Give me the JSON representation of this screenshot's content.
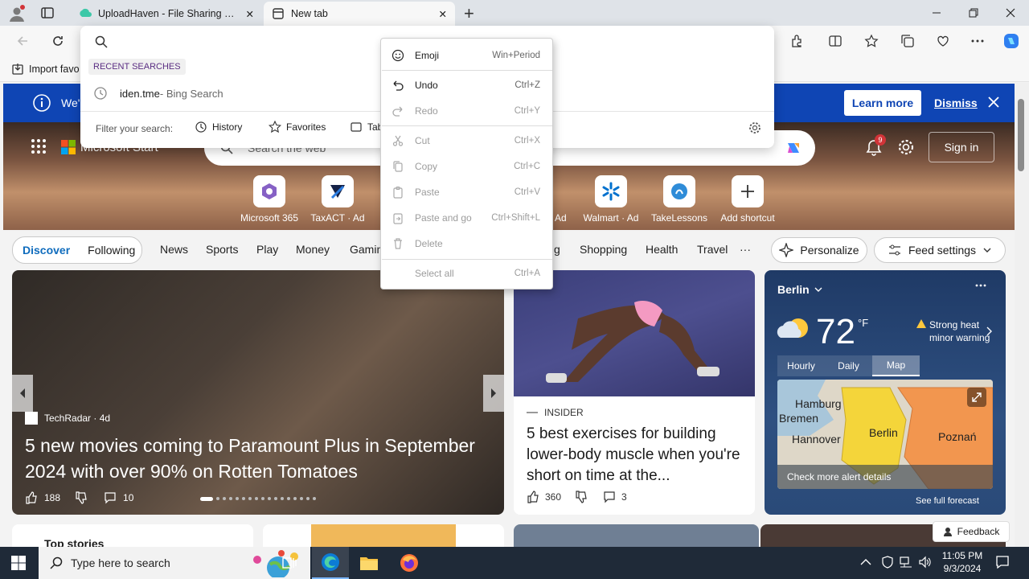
{
  "browser": {
    "tabs": [
      {
        "title": "UploadHaven - File Sharing Made"
      },
      {
        "title": "New tab"
      }
    ],
    "favorites_bar": {
      "import_label": "Import favo"
    }
  },
  "omnibox": {
    "recent_header": "RECENT SEARCHES",
    "recent_item": "iden.tme",
    "recent_item_suffix": " - Bing Search",
    "filter_label": "Filter your search:",
    "filters": [
      "History",
      "Favorites",
      "Tab"
    ]
  },
  "context_menu": {
    "items": [
      {
        "label": "Emoji",
        "shortcut": "Win+Period",
        "enabled": true
      },
      {
        "label": "Undo",
        "shortcut": "Ctrl+Z",
        "enabled": true
      },
      {
        "label": "Redo",
        "shortcut": "Ctrl+Y",
        "enabled": false
      },
      {
        "label": "Cut",
        "shortcut": "Ctrl+X",
        "enabled": false
      },
      {
        "label": "Copy",
        "shortcut": "Ctrl+C",
        "enabled": false
      },
      {
        "label": "Paste",
        "shortcut": "Ctrl+V",
        "enabled": false
      },
      {
        "label": "Paste and go",
        "shortcut": "Ctrl+Shift+L",
        "enabled": false
      },
      {
        "label": "Delete",
        "shortcut": "",
        "enabled": false
      },
      {
        "label": "Select all",
        "shortcut": "Ctrl+A",
        "enabled": false
      }
    ]
  },
  "banner": {
    "text": "We'",
    "learn_more": "Learn more",
    "dismiss": "Dismiss"
  },
  "msn": {
    "brand": "Microsoft Start",
    "search_placeholder": "Search the web",
    "notification_count": "9",
    "sign_in": "Sign in",
    "shortcuts": [
      {
        "label": "Microsoft 365"
      },
      {
        "label": "TaxACT · Ad"
      },
      {
        "label": "· Ad"
      },
      {
        "label": "Walmart · Ad"
      },
      {
        "label": "TakeLessons"
      },
      {
        "label": "Add shortcut"
      }
    ],
    "nav": {
      "discover": "Discover",
      "following": "Following",
      "items": [
        "News",
        "Sports",
        "Play",
        "Money",
        "Gamin",
        "g",
        "Shopping",
        "Health",
        "Travel",
        "···"
      ],
      "personalize": "Personalize",
      "feed_settings": "Feed settings"
    }
  },
  "cards": {
    "main": {
      "source": "TechRadar · 4d",
      "headline": "5 new movies coming to Paramount Plus in September 2024 with over 90% on Rotten Tomatoes",
      "likes": "188",
      "comments": "10"
    },
    "side": {
      "source": "INSIDER",
      "headline": "5 best exercises for building lower-body muscle when you're short on time at the...",
      "likes": "360",
      "comments": "3"
    },
    "weather": {
      "city": "Berlin",
      "temp": "72",
      "unit": "°F",
      "alert": "Strong heat minor warning",
      "tabs": [
        "Hourly",
        "Daily",
        "Map"
      ],
      "map_labels": [
        "Hamburg",
        "Bremen",
        "Hannover",
        "Berlin",
        "Poznań"
      ],
      "alert_link": "Check more alert details",
      "forecast_link": "See full forecast"
    },
    "top_stories": "Top stories"
  },
  "feedback": "Feedback",
  "taskbar": {
    "search_placeholder": "Type here to search",
    "time": "11:05 PM",
    "date": "9/3/2024"
  },
  "colors": {
    "banner_blue": "#0f45b4",
    "accent": "#0f6cbd",
    "taskbar": "#1f2a38"
  }
}
